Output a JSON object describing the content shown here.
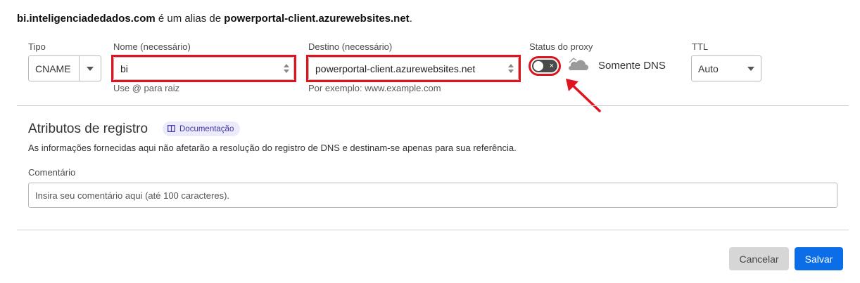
{
  "alias": {
    "domain": "bi.inteligenciadedados.com",
    "middle": " é um alias de ",
    "target": "powerportal-client.azurewebsites.net",
    "end": "."
  },
  "fields": {
    "type": {
      "label": "Tipo",
      "value": "CNAME"
    },
    "name": {
      "label": "Nome (necessário)",
      "value": "bi",
      "hint": "Use @ para raiz"
    },
    "destination": {
      "label": "Destino (necessário)",
      "value": "powerportal-client.azurewebsites.net",
      "hint": "Por exemplo: www.example.com"
    },
    "proxy": {
      "label": "Status do proxy",
      "state": "off",
      "toggle_mark": "×",
      "text": "Somente DNS"
    },
    "ttl": {
      "label": "TTL",
      "value": "Auto"
    }
  },
  "attributes": {
    "title": "Atributos de registro",
    "doc_link": "Documentação",
    "description": "As informações fornecidas aqui não afetarão a resolução do registro de DNS e destinam-se apenas para sua referência.",
    "comment_label": "Comentário",
    "comment_placeholder": "Insira seu comentário aqui (até 100 caracteres)."
  },
  "actions": {
    "cancel": "Cancelar",
    "save": "Salvar"
  },
  "colors": {
    "highlight": "#e0141e",
    "primary": "#0b6ee8",
    "toggle_off": "#4a4a4a"
  },
  "icons": [
    "chevron-down-icon",
    "spinner-icon",
    "cloud-icon",
    "book-icon",
    "arrow-icon"
  ]
}
